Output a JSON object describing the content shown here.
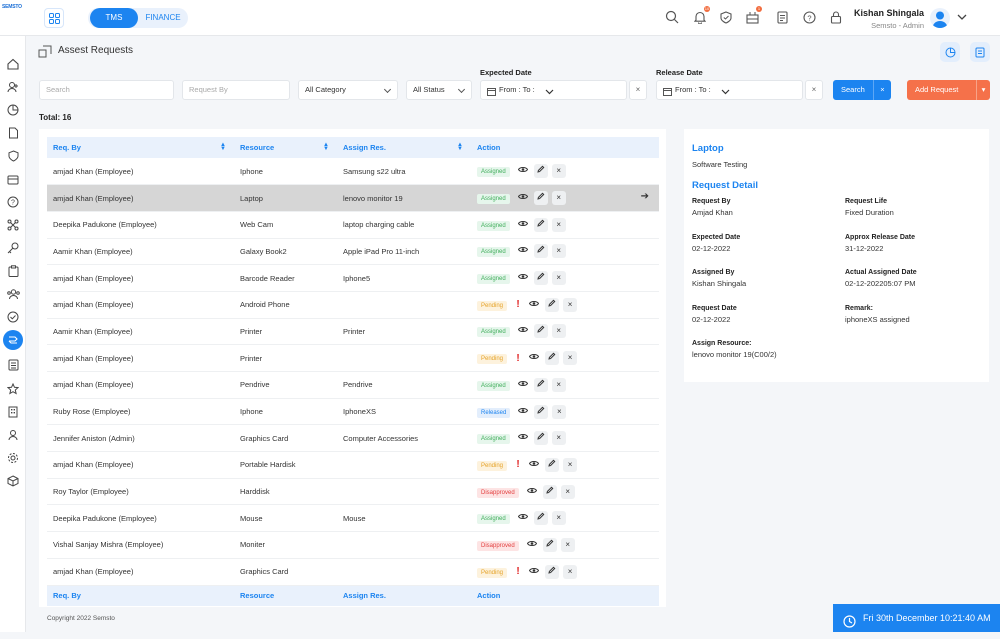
{
  "app": {
    "logo": "SEMSTO"
  },
  "header": {
    "tabs": [
      "TMS",
      "FINANCE"
    ],
    "user_name": "Kishan Shingala",
    "user_role": "Semsto - Admin",
    "notification_badge": "10",
    "cart_badge": "1"
  },
  "page": {
    "title": "Assest Requests"
  },
  "filters": {
    "search_placeholder": "Search",
    "request_by_placeholder": "Request By",
    "category": "All Category",
    "status": "All Status",
    "expected_date_label": "Expected Date",
    "release_date_label": "Release Date",
    "expected_range": "From : To :",
    "release_range": "From : To :",
    "clear_symbol": "×",
    "search_button": "Search",
    "add_request_button": "Add Request"
  },
  "total": "Total: 16",
  "table": {
    "columns": [
      "Req. By",
      "Resource",
      "Assign Res.",
      "Action"
    ],
    "rows": [
      {
        "req_by": "amjad Khan (Employee)",
        "resource": "Iphone",
        "assign": "Samsung s22 ultra",
        "status": "Assigned"
      },
      {
        "req_by": "amjad Khan (Employee)",
        "resource": "Laptop",
        "assign": "lenovo monitor 19",
        "status": "Assigned",
        "selected": true
      },
      {
        "req_by": "Deepika Padukone (Employee)",
        "resource": "Web Cam",
        "assign": "laptop charging cable",
        "status": "Assigned"
      },
      {
        "req_by": "Aamir Khan (Employee)",
        "resource": "Galaxy Book2",
        "assign": "Apple iPad Pro 11-inch",
        "status": "Assigned"
      },
      {
        "req_by": "amjad Khan (Employee)",
        "resource": "Barcode Reader",
        "assign": "Iphone5",
        "status": "Assigned"
      },
      {
        "req_by": "amjad Khan (Employee)",
        "resource": "Android Phone",
        "assign": "",
        "status": "Pending"
      },
      {
        "req_by": "Aamir Khan (Employee)",
        "resource": "Printer",
        "assign": "Printer",
        "status": "Assigned"
      },
      {
        "req_by": "amjad Khan (Employee)",
        "resource": "Printer",
        "assign": "",
        "status": "Pending"
      },
      {
        "req_by": "amjad Khan (Employee)",
        "resource": "Pendrive",
        "assign": "Pendrive",
        "status": "Assigned"
      },
      {
        "req_by": "Ruby Rose (Employee)",
        "resource": "Iphone",
        "assign": "IphoneXS",
        "status": "Released"
      },
      {
        "req_by": "Jennifer Aniston (Admin)",
        "resource": "Graphics Card",
        "assign": "Computer Accessories",
        "status": "Assigned"
      },
      {
        "req_by": "amjad Khan (Employee)",
        "resource": "Portable Hardisk",
        "assign": "",
        "status": "Pending"
      },
      {
        "req_by": "Roy Taylor (Employee)",
        "resource": "Harddisk",
        "assign": "",
        "status": "Disapproved"
      },
      {
        "req_by": "Deepika Padukone (Employee)",
        "resource": "Mouse",
        "assign": "Mouse",
        "status": "Assigned"
      },
      {
        "req_by": "Vishal Sanjay Mishra (Employee)",
        "resource": "Moniter",
        "assign": "",
        "status": "Disapproved"
      },
      {
        "req_by": "amjad Khan (Employee)",
        "resource": "Graphics Card",
        "assign": "",
        "status": "Pending"
      }
    ]
  },
  "detail": {
    "resource": "Laptop",
    "project": "Software Testing",
    "heading": "Request Detail",
    "fields": [
      {
        "label": "Request By",
        "value": "Amjad Khan"
      },
      {
        "label": "Request Life",
        "value": "Fixed Duration"
      },
      {
        "label": "Expected Date",
        "value": "02-12-2022"
      },
      {
        "label": "Approx Release Date",
        "value": "31-12-2022"
      },
      {
        "label": "Assigned By",
        "value": "Kishan Shingala"
      },
      {
        "label": "Actual Assigned Date",
        "value": "02-12-202205:07 PM"
      },
      {
        "label": "Request Date",
        "value": "02-12-2022"
      },
      {
        "label": "Remark:",
        "value": "iphoneXS assigned"
      },
      {
        "label": "Assign Resource:",
        "value": "lenovo monitor 19(C00/2)"
      }
    ]
  },
  "footer": {
    "copyright": "Copyright 2022 Semsto"
  },
  "clock": {
    "text": "Fri 30th December 10:21:40 AM"
  },
  "colors": {
    "primary": "#1c84f0",
    "accent": "#f5714a",
    "assigned": "#3fae5a",
    "pending": "#e5a226",
    "released": "#1c84f0",
    "disapproved": "#e34040"
  }
}
